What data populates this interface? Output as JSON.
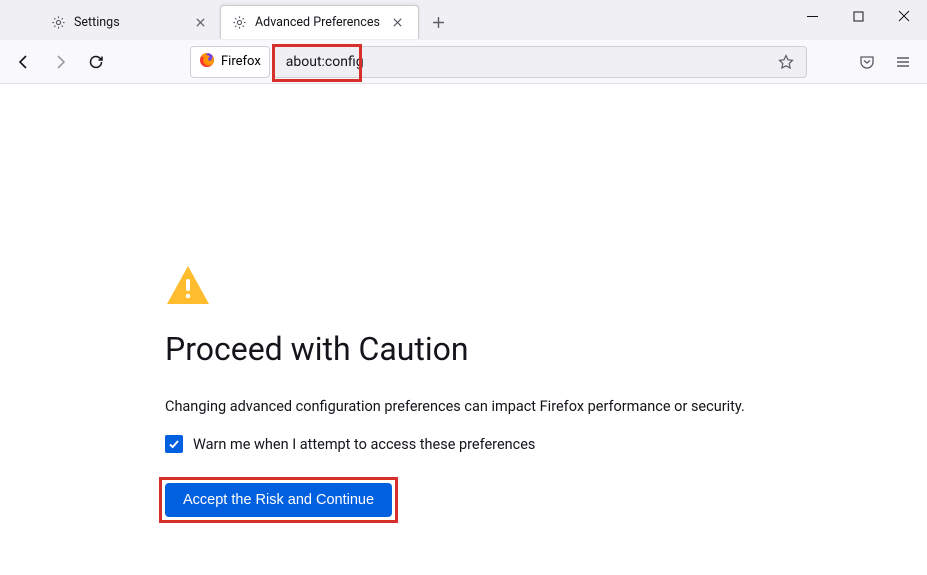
{
  "tabs": [
    {
      "label": "Settings",
      "active": false
    },
    {
      "label": "Advanced Preferences",
      "active": true
    }
  ],
  "identity_label": "Firefox",
  "url": "about:config",
  "page": {
    "heading": "Proceed with Caution",
    "description": "Changing advanced configuration preferences can impact Firefox performance or security.",
    "checkbox_label": "Warn me when I attempt to access these preferences",
    "checkbox_checked": true,
    "accept_label": "Accept the Risk and Continue"
  }
}
